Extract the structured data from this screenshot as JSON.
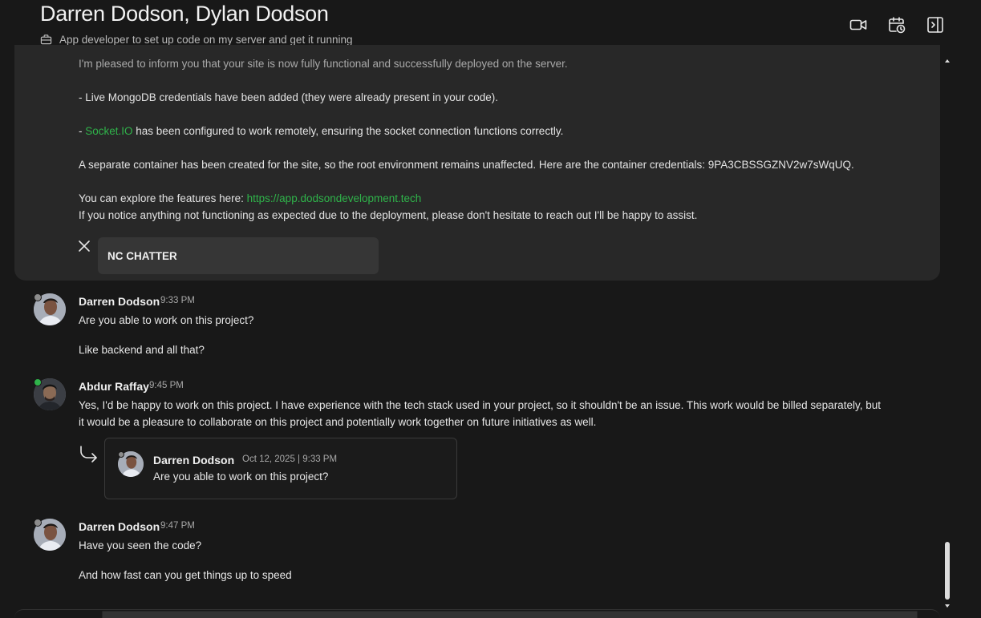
{
  "header": {
    "title": "Darren Dodson, Dylan Dodson",
    "subtitle": "App developer to set up code on my server and get it running",
    "actions": [
      "video-call-icon",
      "schedule-icon",
      "toggle-sidebar-icon"
    ]
  },
  "card": {
    "line1": "I'm pleased to inform you that your site is now fully functional and successfully deployed on the server.",
    "line2": "- Live MongoDB credentials have been added (they were already present in your code).",
    "line3_prefix": "- ",
    "line3_link": "Socket.IO",
    "line3_rest": " has been configured to work remotely, ensuring the socket connection functions correctly.",
    "line4": "A separate container has been created for the site, so the root environment remains unaffected. Here are the container credentials: 9PA3CBSSGZNV2w7sWqUQ.",
    "line5_prefix": "You can explore the features here: ",
    "line5_link": "https://app.dodsondevelopment.tech",
    "line6": "If you notice anything not functioning as expected due to the deployment, please don't hesitate to reach out I'll be happy to assist.",
    "attachment": "NC CHATTER"
  },
  "messages": [
    {
      "author": "Darren Dodson",
      "time": "9:33 PM",
      "lines": [
        "Are you able to work on this project?",
        "Like backend and all that?"
      ]
    },
    {
      "author": "Abdur Raffay",
      "time": "9:45 PM",
      "lines": [
        "Yes, I'd be happy to work on this project. I have experience with the tech stack used in your project, so it shouldn't be an issue. This work would be billed separately, but",
        "it would be a pleasure to collaborate on this project and potentially work together on future initiatives as well."
      ],
      "quote": {
        "author": "Darren Dodson",
        "time": "Oct 12, 2025 | 9:33 PM",
        "text": "Are you able to work on this project?"
      }
    },
    {
      "author": "Darren Dodson",
      "time": "9:47 PM",
      "lines": [
        "Have you seen the code?",
        "And how fast can you get things up to speed"
      ]
    }
  ],
  "colors": {
    "background": "#181818",
    "card": "#282828",
    "link": "#2fb34a",
    "online": "#2fb34a",
    "offline": "#8c8c8c"
  }
}
